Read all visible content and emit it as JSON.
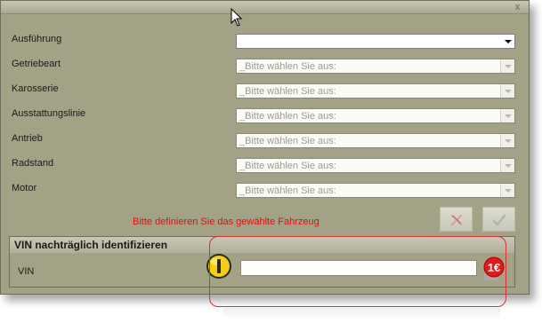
{
  "window": {
    "close_glyph": "x"
  },
  "fields": [
    {
      "label": "Ausführung",
      "value": "",
      "enabled": true
    },
    {
      "label": "Getriebeart",
      "value": "_Bitte wählen Sie aus:",
      "enabled": false
    },
    {
      "label": "Karosserie",
      "value": "_Bitte wählen Sie aus:",
      "enabled": false
    },
    {
      "label": "Ausstattungslinie",
      "value": "_Bitte wählen Sie aus:",
      "enabled": false
    },
    {
      "label": "Antrieb",
      "value": "_Bitte wählen Sie aus:",
      "enabled": false
    },
    {
      "label": "Radstand",
      "value": "_Bitte wählen Sie aus:",
      "enabled": false
    },
    {
      "label": "Motor",
      "value": "_Bitte wählen Sie aus:",
      "enabled": false
    }
  ],
  "hint": "Bitte definieren Sie das gewählte Fahrzeug",
  "buttons": {
    "cancel_icon": "x-icon",
    "confirm_icon": "check-icon"
  },
  "vin_section": {
    "title": "VIN nachträglich identifizieren",
    "label": "VIN",
    "value": "",
    "info_icon": "info-icon",
    "paid_badge": "1€"
  },
  "colors": {
    "window_bg": "#a3a286",
    "hint": "#e01010",
    "highlight": "#dc2f2f"
  }
}
